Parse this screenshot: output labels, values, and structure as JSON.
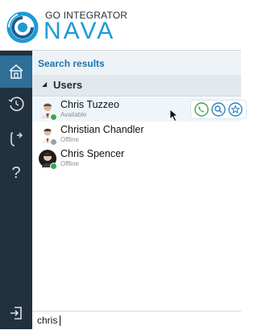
{
  "brand": {
    "top_text": "GO INTEGRATOR",
    "main_text": "NAVA"
  },
  "sidebar": {
    "items": [
      {
        "icon": "home-icon",
        "active": true
      },
      {
        "icon": "history-icon",
        "active": false
      },
      {
        "icon": "phone-transfer-icon",
        "active": false
      },
      {
        "icon": "help-icon",
        "label": "?",
        "active": false
      },
      {
        "icon": "logout-icon",
        "active": false
      }
    ]
  },
  "results": {
    "title": "Search results"
  },
  "group": {
    "label": "Users",
    "expanded": true
  },
  "contacts": [
    {
      "name": "Chris Tuzzeo",
      "status": "Available",
      "status_color": "#3fa34d",
      "selected": true
    },
    {
      "name": "Christian Chandler",
      "status": "Offline",
      "status_color": "#9aa3ab",
      "selected": false
    },
    {
      "name": "Chris Spencer",
      "status": "Offline",
      "status_color": "#3fa34d",
      "selected": false
    }
  ],
  "actions": [
    {
      "icon": "phone-icon",
      "color": "#3fa34d"
    },
    {
      "icon": "search-icon",
      "color": "#2e86c1"
    },
    {
      "icon": "star-icon",
      "color": "#2e86c1"
    }
  ],
  "search": {
    "value": "chris"
  },
  "colors": {
    "accent": "#1d9ad6",
    "sidebar_bg": "#22313e",
    "sidebar_active": "#2e6e97"
  }
}
